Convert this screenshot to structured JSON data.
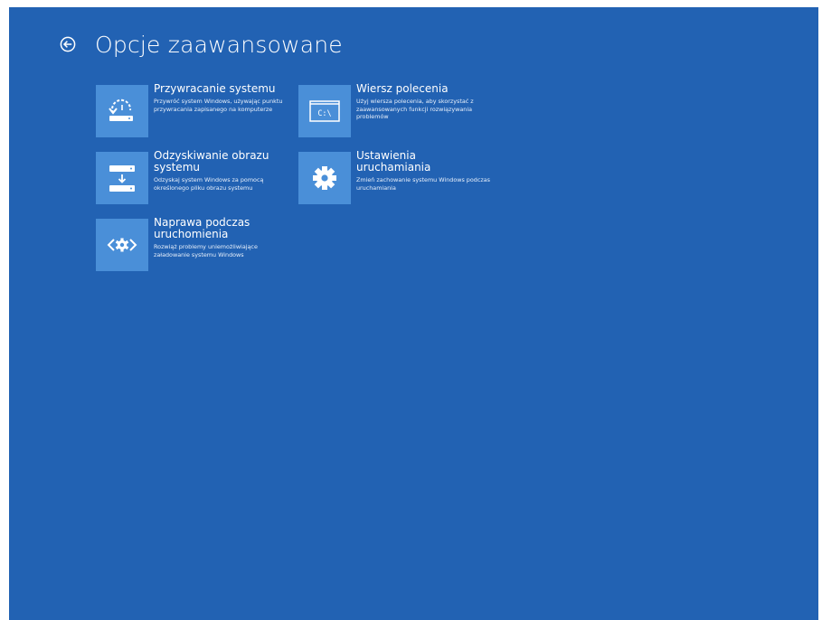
{
  "page": {
    "title": "Opcje zaawansowane"
  },
  "colors": {
    "background": "#2262b3",
    "tile_icon_bg": "#4a8fd8",
    "text": "#ffffff"
  },
  "tiles": [
    {
      "title": "Przywracanie systemu",
      "description": "Przywróć system Windows, używając punktu przywracania zapisanego na komputerze",
      "icon": "system-restore-icon"
    },
    {
      "title": "Wiersz polecenia",
      "description": "Użyj wiersza polecenia, aby skorzystać z zaawansowanych funkcji rozwiązywania problemów",
      "icon": "command-prompt-icon",
      "icon_text": "C:\\"
    },
    {
      "title": "Odzyskiwanie obrazu systemu",
      "description": "Odzyskaj system Windows za pomocą określonego pliku obrazu systemu",
      "icon": "system-image-recovery-icon"
    },
    {
      "title": "Ustawienia uruchamiania",
      "description": "Zmień zachowanie systemu Windows podczas uruchamiania",
      "icon": "gear-icon"
    },
    {
      "title": "Naprawa podczas uruchomienia",
      "description": "Rozwiąż problemy uniemożliwiające załadowanie systemu Windows",
      "icon": "startup-repair-icon"
    }
  ]
}
